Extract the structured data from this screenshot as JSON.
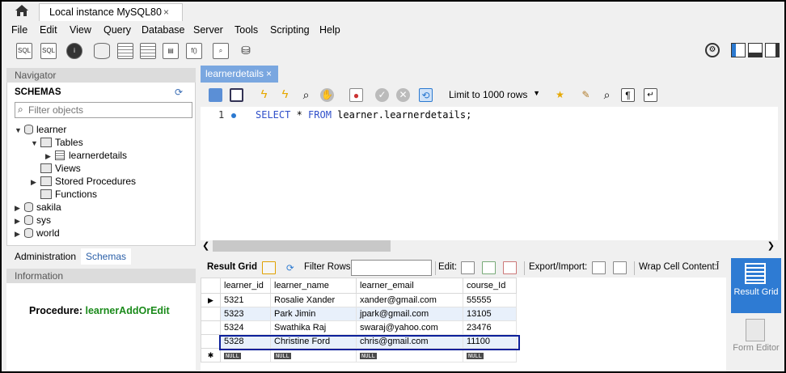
{
  "window": {
    "tab_title": "Local instance MySQL80",
    "close": "×"
  },
  "menu": [
    "File",
    "Edit",
    "View",
    "Query",
    "Database",
    "Server",
    "Tools",
    "Scripting",
    "Help"
  ],
  "toolbar": {
    "sql1": "SQL",
    "sql2": "SQL"
  },
  "navigator": {
    "header": "Navigator",
    "schemas_title": "SCHEMAS",
    "filter_placeholder": "Filter objects",
    "tree": {
      "learner": "learner",
      "tables": "Tables",
      "learnerdetails": "learnerdetails",
      "views": "Views",
      "stored_procedures": "Stored Procedures",
      "functions": "Functions",
      "sakila": "sakila",
      "sys": "sys",
      "world": "world"
    },
    "tabs": {
      "administration": "Administration",
      "schemas": "Schemas"
    },
    "info_header": "Information",
    "procedure_label": "Procedure:",
    "procedure_name": "learnerAddOrEdit"
  },
  "editor": {
    "tab": "learnerdetails",
    "limit": "Limit to 1000 rows",
    "line_number": "1",
    "sql_kw1": "SELECT",
    "sql_mid": " * ",
    "sql_kw2": "FROM",
    "sql_rest": " learner.learnerdetails;"
  },
  "results": {
    "result_grid": "Result Grid",
    "filter_rows": "Filter Rows:",
    "edit": "Edit:",
    "export_import": "Export/Import:",
    "wrap": "Wrap Cell Content:",
    "columns": [
      "learner_id",
      "learner_name",
      "learner_email",
      "course_Id"
    ],
    "rows": [
      [
        "5321",
        "Rosalie Xander",
        "xander@gmail.com",
        "55555"
      ],
      [
        "5323",
        "Park Jimin",
        "jpark@gmail.com",
        "13105"
      ],
      [
        "5324",
        "Swathika Raj",
        "swaraj@yahoo.com",
        "23476"
      ],
      [
        "5328",
        "Christine Ford",
        "chris@gmail.com",
        "11100"
      ]
    ],
    "null": "NULL"
  },
  "side": {
    "result_grid": "Result Grid",
    "form_editor": "Form Editor"
  }
}
